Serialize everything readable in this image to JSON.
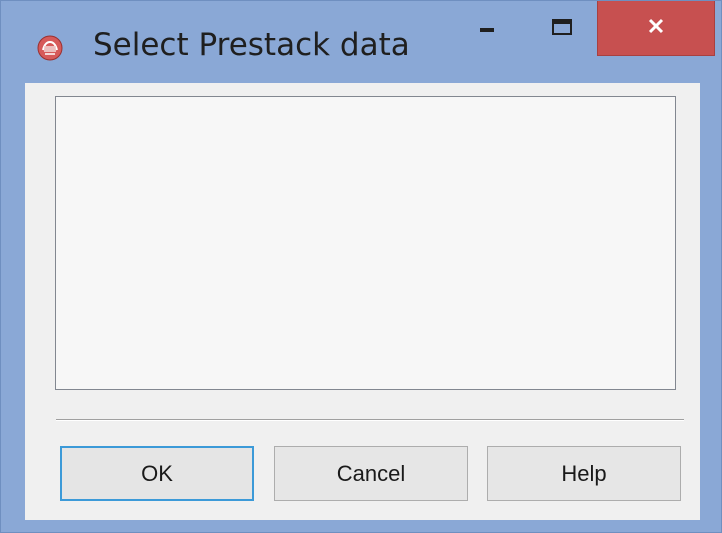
{
  "window": {
    "title": "Select Prestack data"
  },
  "titlebar": {
    "minimize_icon": "minimize-icon",
    "maximize_icon": "maximize-icon",
    "close_icon": "close-icon",
    "close_color": "#c75050"
  },
  "listbox": {
    "items": []
  },
  "buttons": {
    "ok_label": "OK",
    "cancel_label": "Cancel",
    "help_label": "Help"
  },
  "colors": {
    "frame": "#8aa8d6",
    "default_button_border": "#3c9ad8"
  }
}
